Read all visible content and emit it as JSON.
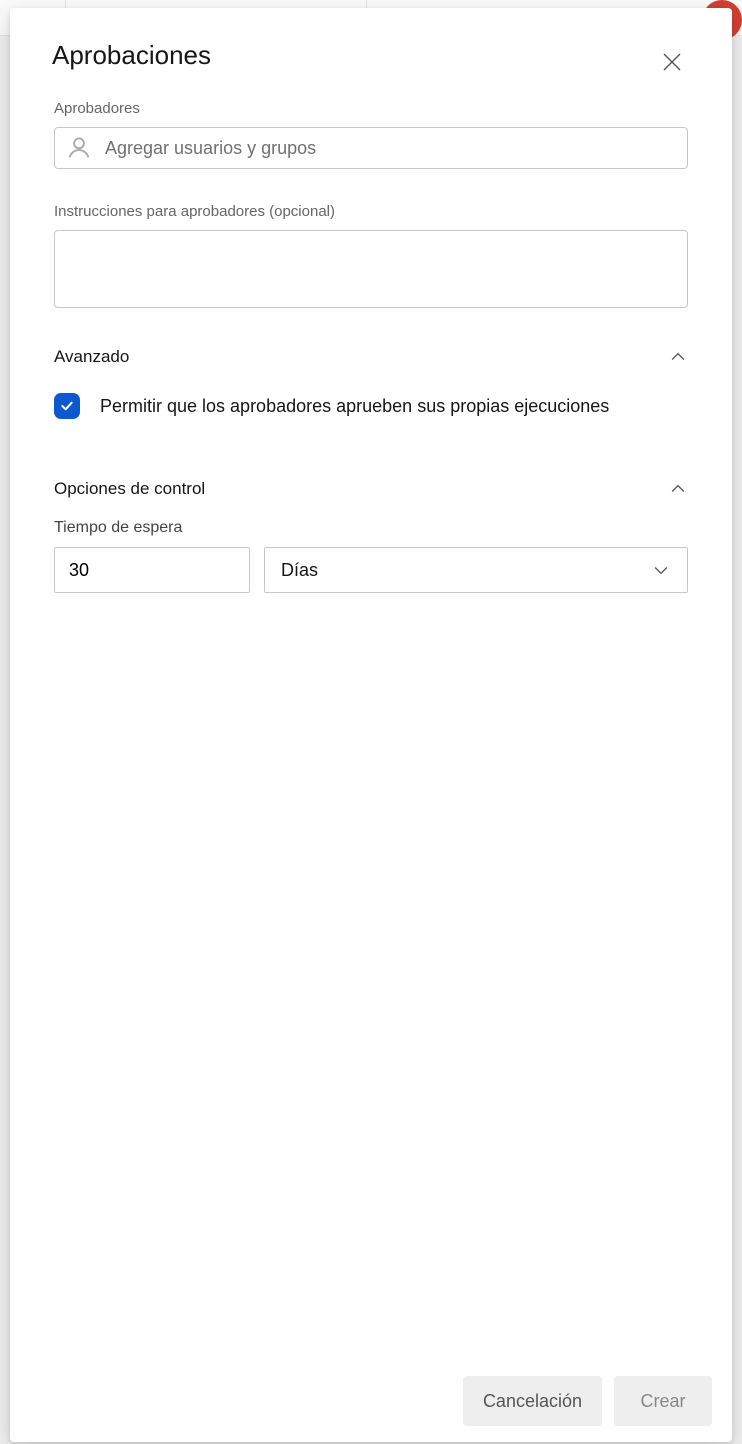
{
  "panel": {
    "title": "Aprobaciones"
  },
  "approvers": {
    "label": "Aprobadores",
    "placeholder": "Agregar usuarios y grupos",
    "value": ""
  },
  "instructions": {
    "label": "Instrucciones para aprobadores (opcional)",
    "value": ""
  },
  "advanced": {
    "title": "Avanzado",
    "checkbox_label": "Permitir que los aprobadores aprueben sus propias ejecuciones",
    "checked": true
  },
  "control": {
    "title": "Opciones de control",
    "timeout_label": "Tiempo de espera",
    "timeout_value": "30",
    "timeout_unit": "Días"
  },
  "footer": {
    "cancel": "Cancelación",
    "create": "Crear"
  }
}
